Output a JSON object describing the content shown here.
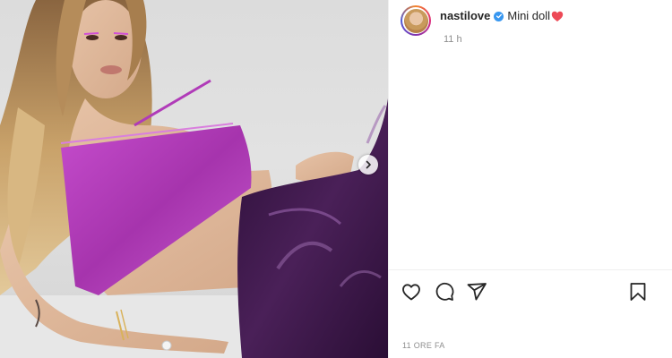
{
  "post": {
    "username": "nastilove",
    "verified": true,
    "caption": "Mini doll",
    "caption_emoji": "red-heart",
    "caption_time": "11 h",
    "posted_time": "11 ORE FA"
  },
  "actions": {
    "like_icon": "heart-outline-icon",
    "comment_icon": "comment-icon",
    "share_icon": "paper-plane-icon",
    "save_icon": "bookmark-icon"
  },
  "carousel": {
    "next_icon": "chevron-right-icon"
  },
  "colors": {
    "verified_blue": "#3897f0",
    "heart_red": "#ed4956",
    "top_magenta": "#b03bb8",
    "pants_purple": "#3a1846",
    "muted_text": "#8e8e8e"
  }
}
